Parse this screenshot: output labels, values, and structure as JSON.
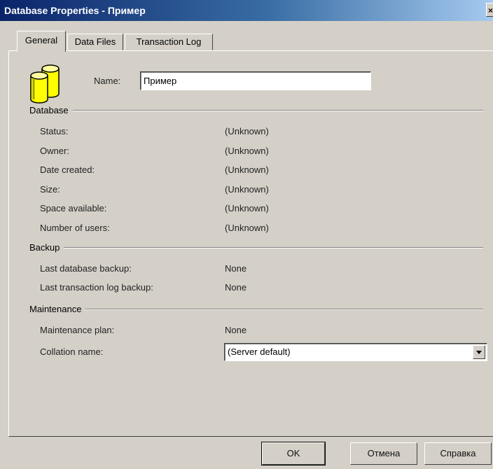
{
  "window": {
    "title": "Database Properties - Пример",
    "close_glyph": "×"
  },
  "tabs": [
    {
      "label": "General",
      "active": true
    },
    {
      "label": "Data Files",
      "active": false
    },
    {
      "label": "Transaction Log",
      "active": false
    }
  ],
  "name_field": {
    "label": "Name:",
    "value": "Пример"
  },
  "database": {
    "heading": "Database",
    "rows": [
      {
        "label": "Status:",
        "value": "(Unknown)"
      },
      {
        "label": "Owner:",
        "value": "(Unknown)"
      },
      {
        "label": "Date created:",
        "value": "(Unknown)"
      },
      {
        "label": "Size:",
        "value": "(Unknown)"
      },
      {
        "label": "Space available:",
        "value": "(Unknown)"
      },
      {
        "label": "Number of users:",
        "value": "(Unknown)"
      }
    ]
  },
  "backup": {
    "heading": "Backup",
    "rows": [
      {
        "label": "Last database backup:",
        "value": "None"
      },
      {
        "label": "Last transaction log backup:",
        "value": "None"
      }
    ]
  },
  "maintenance": {
    "heading": "Maintenance",
    "plan": {
      "label": "Maintenance plan:",
      "value": "None"
    },
    "collation": {
      "label": "Collation name:",
      "value": "(Server default)"
    }
  },
  "buttons": {
    "ok": "OK",
    "cancel": "Отмена",
    "help": "Справка"
  },
  "colors": {
    "titlebar_start": "#0a246a",
    "titlebar_end": "#a6caf0",
    "face": "#d4d0c8",
    "db_icon": "#ffff00"
  }
}
